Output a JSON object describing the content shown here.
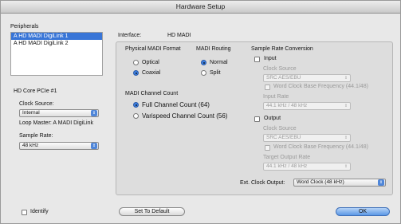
{
  "window": {
    "title": "Hardware Setup"
  },
  "peripherals": {
    "label": "Peripherals",
    "items": [
      {
        "label": "A HD MADI DigiLink 1",
        "selected": true
      },
      {
        "label": "A HD MADI DigiLink 2",
        "selected": false
      }
    ]
  },
  "core": {
    "label": "HD Core PCIe #1",
    "clock_source_label": "Clock Source:",
    "clock_source_value": "Internal",
    "loop_master": "Loop Master: A MADI DigiLink",
    "sample_rate_label": "Sample Rate:",
    "sample_rate_value": "48 kHz"
  },
  "interface": {
    "label": "Interface:",
    "value": "HD MADI"
  },
  "madi_format": {
    "label": "Physical MADI Format",
    "options": [
      "Optical",
      "Coaxial"
    ],
    "selected": "Coaxial"
  },
  "madi_routing": {
    "label": "MADI Routing",
    "options": [
      "Normal",
      "Split"
    ],
    "selected": "Normal"
  },
  "channel_count": {
    "label": "MADI Channel Count",
    "options": [
      "Full Channel Count (64)",
      "Varispeed Channel Count (56)"
    ],
    "selected": "Full Channel Count (64)"
  },
  "src": {
    "label": "Sample Rate Conversion",
    "input": {
      "label": "Input",
      "clock_source_label": "Clock Source",
      "clock_source_value": "SRC AES/EBU",
      "word_clock_label": "Word Clock Base Frequency (44.1/48)",
      "rate_label": "Input Rate",
      "rate_value": "44.1 kHz / 48 kHz"
    },
    "output": {
      "label": "Output",
      "clock_source_label": "Clock Source",
      "clock_source_value": "SRC AES/EBU",
      "word_clock_label": "Word Clock Base Frequency (44.1/48)",
      "rate_label": "Target Output Rate",
      "rate_value": "44.1 kHz / 48 kHz"
    }
  },
  "ext_clock": {
    "label": "Ext. Clock Output:",
    "value": "Word Clock (48 kHz)"
  },
  "footer": {
    "identify": "Identify",
    "set_default": "Set To Default",
    "ok": "OK"
  }
}
